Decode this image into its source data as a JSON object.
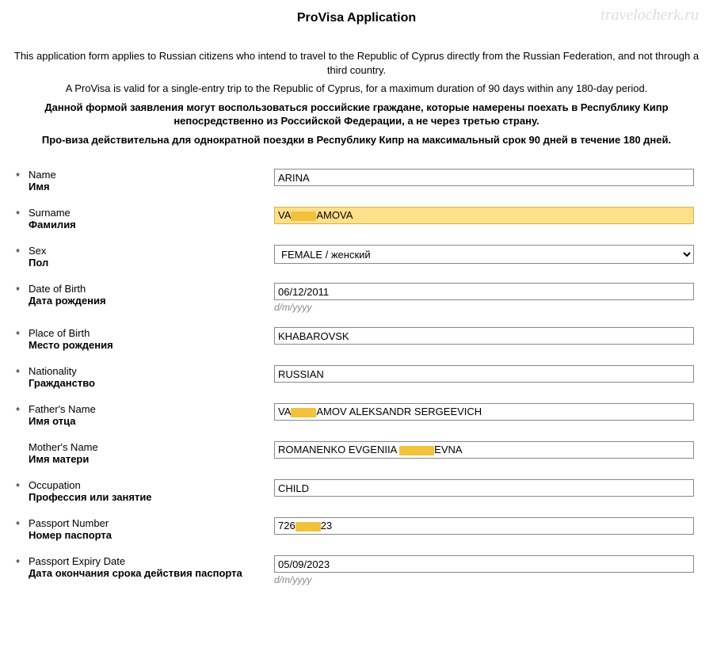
{
  "watermark": "travelocherk.ru",
  "title": "ProVisa Application",
  "intro": {
    "p1": "This application form applies to Russian citizens who intend to travel to the Republic of Cyprus directly from the Russian Federation, and not through a third country.",
    "p2": "A ProVisa is valid for a single-entry trip to the Republic of Cyprus, for a maximum duration of 90 days within any 180-day period.",
    "p3": "Данной формой заявления могут воспользоваться российские граждане, которые намерены поехать в Республику Кипр непосредственно из Российской Федерации, а не через третью страну.",
    "p4": "Про-виза действительна для однократной поездки в Республику Кипр на максимальный срок 90 дней в течение 180 дней."
  },
  "star": "*",
  "date_hint": "d/m/yyyy",
  "fields": {
    "name": {
      "en": "Name",
      "ru": "Имя",
      "value": "ARINA",
      "required": true
    },
    "surname": {
      "en": "Surname",
      "ru": "Фамилия",
      "value_pre": "VA",
      "value_post": "AMOVA",
      "required": true,
      "highlight": true,
      "redact_w": 32
    },
    "sex": {
      "en": "Sex",
      "ru": "Пол",
      "value": "FEMALE / женский",
      "required": true
    },
    "dob": {
      "en": "Date of Birth",
      "ru": "Дата рождения",
      "value": "06/12/2011",
      "required": true
    },
    "pob": {
      "en": "Place of Birth",
      "ru": "Место рождения",
      "value": "KHABAROVSK",
      "required": true
    },
    "nat": {
      "en": "Nationality",
      "ru": "Гражданство",
      "value": "RUSSIAN",
      "required": true
    },
    "father": {
      "en": "Father's Name",
      "ru": "Имя отца",
      "value_pre": "VA",
      "value_post": "AMOV ALEKSANDR SERGEEVICH",
      "required": true,
      "redact_w": 32
    },
    "mother": {
      "en": "Mother's Name",
      "ru": "Имя матери",
      "value_pre": "ROMANENKO EVGENIIA ",
      "value_post": "EVNA",
      "required": false,
      "redact_w": 44
    },
    "occ": {
      "en": "Occupation",
      "ru": "Профессия или занятие",
      "value": "CHILD",
      "required": true
    },
    "ppn": {
      "en": "Passport Number",
      "ru": "Номер паспорта",
      "value_pre": "726",
      "value_post": "23",
      "required": true,
      "redact_w": 32
    },
    "ped": {
      "en": "Passport Expiry Date",
      "ru": "Дата окончания срока действия паспорта",
      "value": "05/09/2023",
      "required": true
    }
  }
}
